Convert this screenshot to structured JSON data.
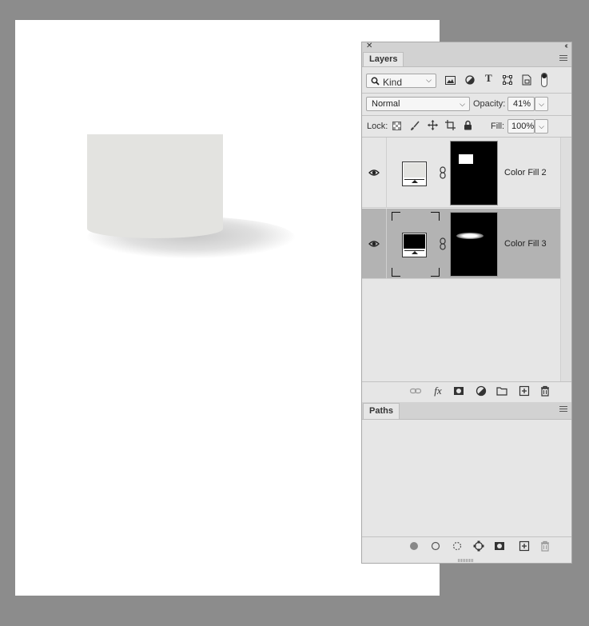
{
  "layers_panel": {
    "tab_label": "Layers",
    "filter": {
      "kind_label": "Kind"
    },
    "blend_mode": "Normal",
    "opacity_label": "Opacity:",
    "opacity_value": "41%",
    "lock_label": "Lock:",
    "fill_label": "Fill:",
    "fill_value": "100%",
    "layers": [
      {
        "name": "Color Fill 2",
        "fill_color": "#e3e3e0",
        "selected": false
      },
      {
        "name": "Color Fill 3",
        "fill_color": "#000000",
        "selected": true
      }
    ]
  },
  "paths_panel": {
    "tab_label": "Paths"
  },
  "document": {
    "shape_color": "#e3e3e0",
    "canvas_color": "#ffffff",
    "pasteboard_color": "#8c8c8c"
  }
}
